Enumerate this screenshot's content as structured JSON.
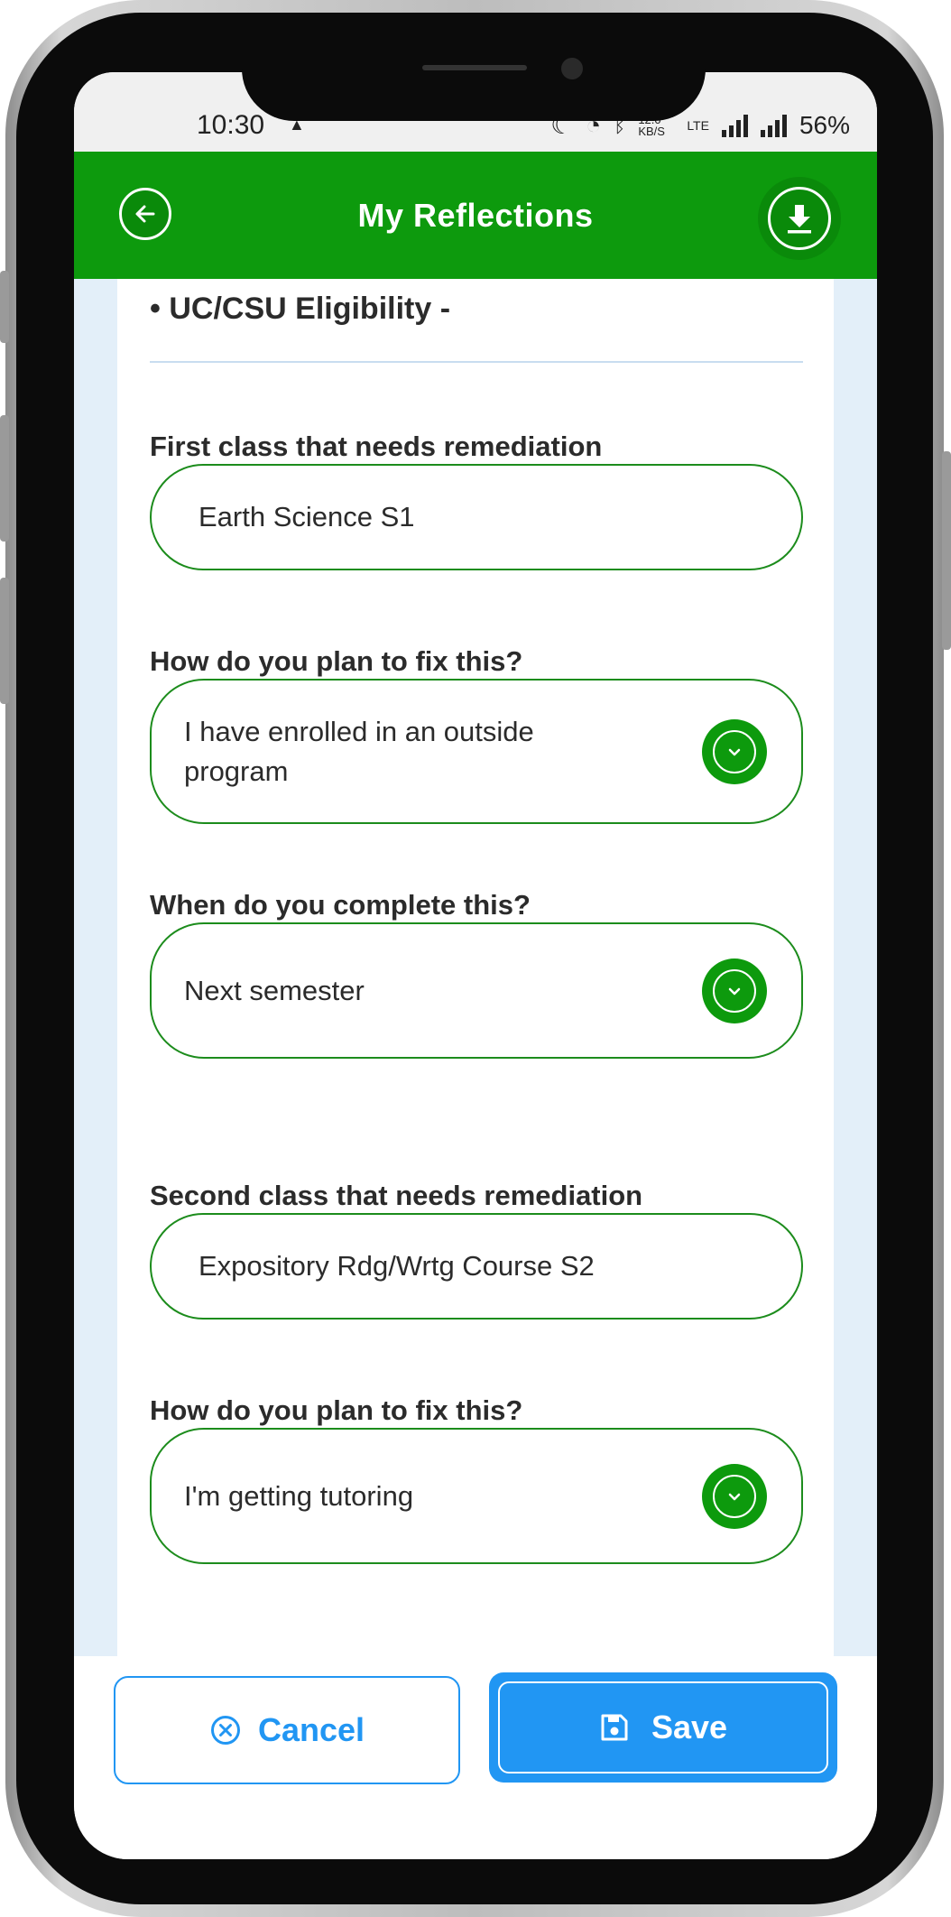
{
  "status_bar": {
    "time": "10:30",
    "network_speed": "12.0 KB/S",
    "battery": "56%",
    "icons": [
      "moon-icon",
      "alarm-icon",
      "bluetooth-icon",
      "volte-icon",
      "signal-icon",
      "roaming-signal-icon"
    ]
  },
  "header": {
    "title": "My Reflections",
    "back_icon": "arrow-left-icon",
    "download_icon": "download-icon",
    "color": "#0d9a0d"
  },
  "section": {
    "heading": "• UC/CSU Eligibility -"
  },
  "first_class": {
    "label": "First class that needs remediation",
    "value": "Earth Science S1",
    "fix_label": "How do you plan to fix this?",
    "fix_value": "I have enrolled in an outside program",
    "when_label": "When do you complete this?",
    "when_value": "Next semester"
  },
  "second_class": {
    "label": "Second class that needs remediation",
    "value": "Expository Rdg/Wrtg Course S2",
    "fix_label": "How do you plan to fix this?",
    "fix_value": "I'm getting tutoring"
  },
  "footer": {
    "cancel_label": "Cancel",
    "save_label": "Save",
    "accent_color": "#2196f3"
  }
}
